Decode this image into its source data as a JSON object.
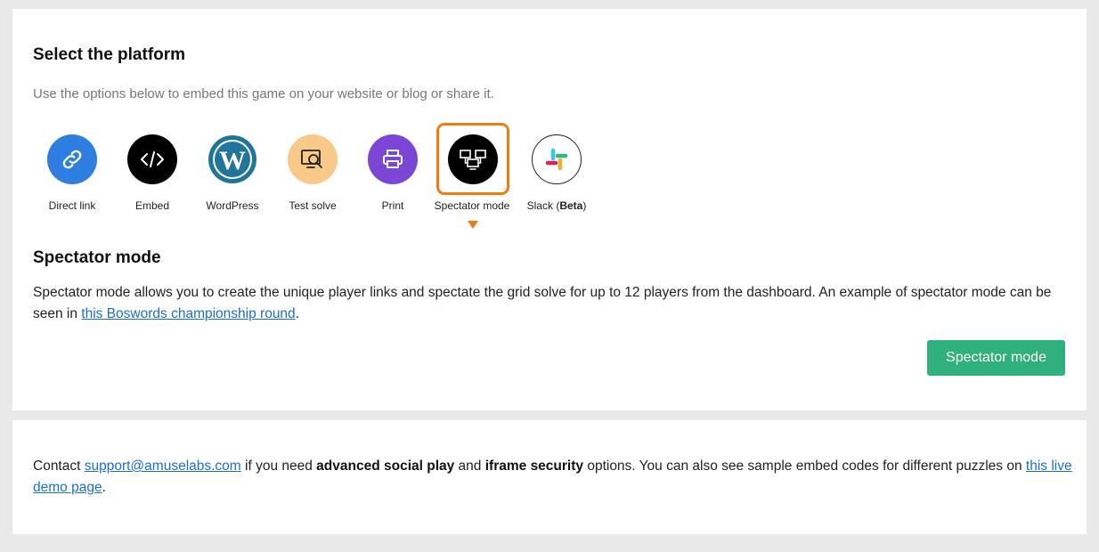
{
  "platform_section": {
    "title": "Select the platform",
    "subtitle": "Use the options below to embed this game on your website or blog or share it.",
    "items": [
      {
        "label": "Direct link",
        "icon": "link-icon",
        "color": "#2d7ee0"
      },
      {
        "label": "Embed",
        "icon": "code-icon",
        "color": "#000000"
      },
      {
        "label": "WordPress",
        "icon": "wordpress-icon",
        "color": "#21759b"
      },
      {
        "label": "Test solve",
        "icon": "test-solve-icon",
        "color": "#f9c98a"
      },
      {
        "label": "Print",
        "icon": "printer-icon",
        "color": "#7b45d6"
      },
      {
        "label": "Spectator mode",
        "icon": "spectator-icon",
        "color": "#000000",
        "selected": true
      },
      {
        "label": "Slack (",
        "label_bold": "Beta",
        "label_end": ")",
        "icon": "slack-icon",
        "color": "#ffffff"
      }
    ]
  },
  "spectator_section": {
    "title": "Spectator mode",
    "description_before": "Spectator mode allows you to create the unique player links and spectate the grid solve for up to 12 players from the dashboard. An example of spectator mode can be seen in ",
    "link_text": "this Boswords championship round",
    "description_after": ".",
    "button_label": "Spectator mode",
    "button_color": "#2fb07c"
  },
  "contact_section": {
    "text_1": "Contact ",
    "email": "support@amuselabs.com",
    "text_2": " if you need ",
    "bold_1": "advanced social play",
    "text_3": " and ",
    "bold_2": "iframe security",
    "text_4": " options. You can also see sample embed codes for different puzzles on ",
    "demo_link": "this live demo page",
    "text_5": "."
  },
  "colors": {
    "accent_selected": "#f07b12",
    "link": "#1a6fd6"
  }
}
